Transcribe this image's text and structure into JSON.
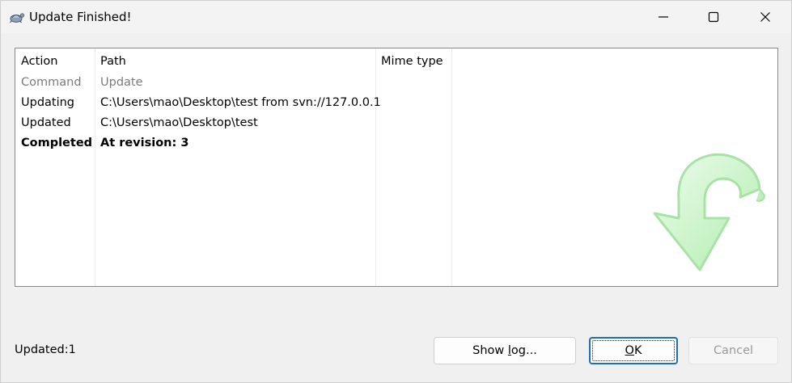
{
  "window": {
    "title": "Update Finished!",
    "minimize_glyph": "minimize-icon",
    "maximize_glyph": "maximize-icon",
    "close_glyph": "close-icon"
  },
  "list": {
    "columns": [
      "Action",
      "Path",
      "Mime type"
    ],
    "rows": [
      {
        "action": "Command",
        "path": "Update",
        "style": "muted"
      },
      {
        "action": "Updating",
        "path": "C:\\Users\\mao\\Desktop\\test from svn://127.0.0.1",
        "style": "normal"
      },
      {
        "action": "Updated",
        "path": "C:\\Users\\mao\\Desktop\\test",
        "style": "normal"
      },
      {
        "action": "Completed",
        "path": "At revision: 3",
        "style": "bold"
      }
    ]
  },
  "footer": {
    "status": "Updated:1",
    "show_log_prefix": "Show ",
    "show_log_accel": "l",
    "show_log_suffix": "og...",
    "ok_accel": "O",
    "ok_suffix": "K",
    "cancel_label": "Cancel"
  },
  "colors": {
    "arrow": "#ccf5cc",
    "ok_border": "#1f6fb8",
    "muted_text": "#7a7a7a"
  }
}
